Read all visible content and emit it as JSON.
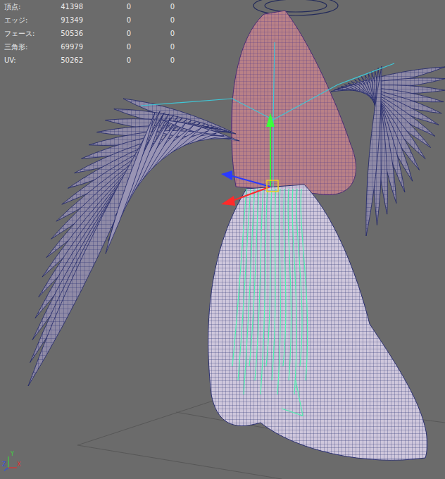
{
  "viewport": {
    "hud": {
      "rows": [
        {
          "label": "頂点:",
          "values": [
            "41398",
            "0",
            "0"
          ]
        },
        {
          "label": "エッジ:",
          "values": [
            "91349",
            "0",
            "0"
          ]
        },
        {
          "label": "フェース:",
          "values": [
            "50536",
            "0",
            "0"
          ]
        },
        {
          "label": "三角形:",
          "values": [
            "69979",
            "0",
            "0"
          ]
        },
        {
          "label": "UV:",
          "values": [
            "50262",
            "0",
            "0"
          ]
        }
      ]
    },
    "axis": {
      "labels": [
        "Y",
        "Z",
        "X"
      ]
    }
  }
}
